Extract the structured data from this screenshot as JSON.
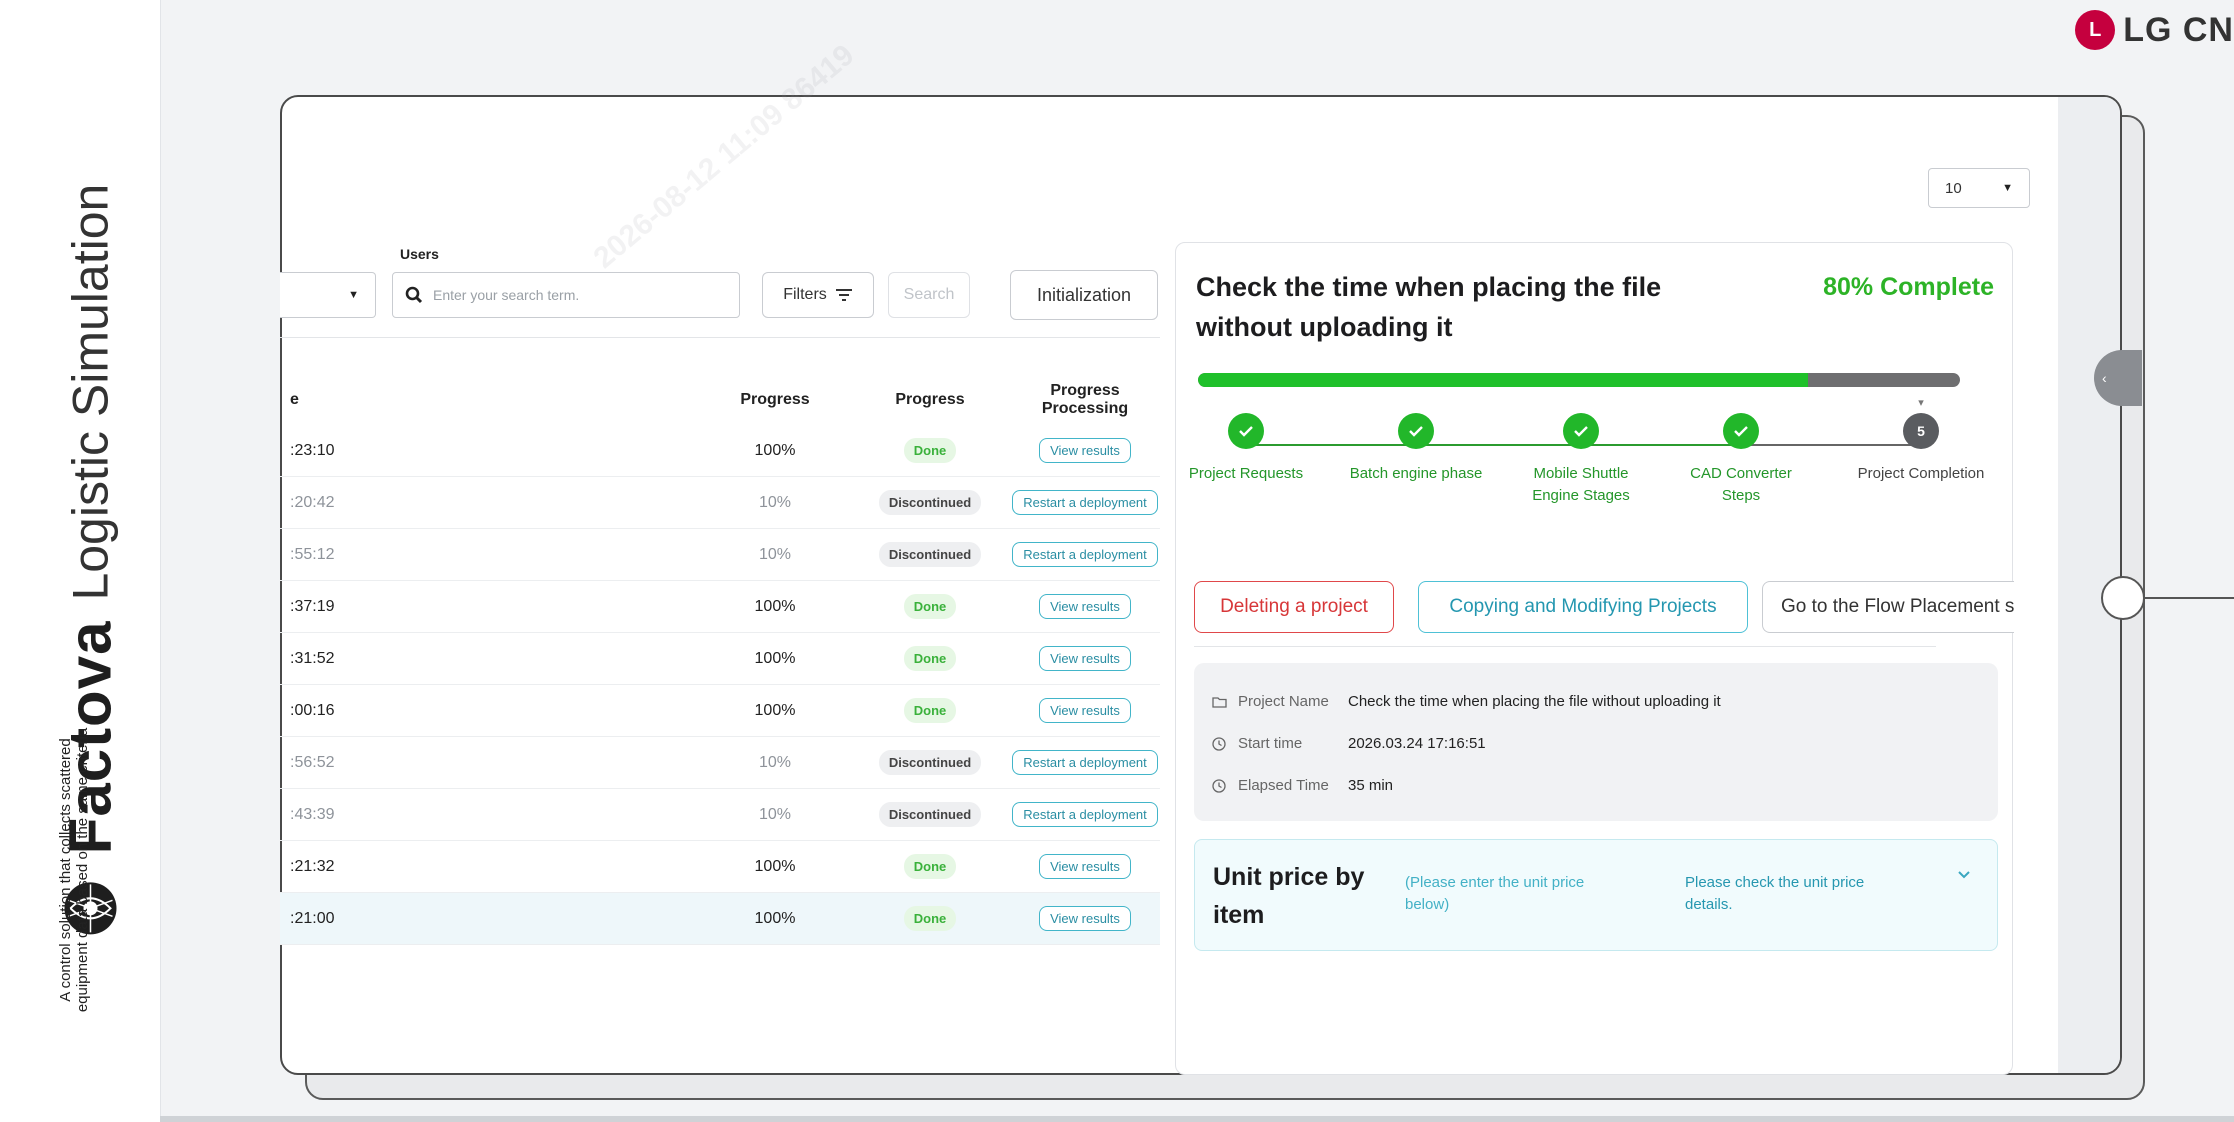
{
  "brand": {
    "name": "Factova",
    "subtitle": "Logistic Simulation",
    "tagline": "A control solution that collects scattered equipment data based on the same criteria"
  },
  "lg_logo": {
    "text": "LG CN",
    "color": "#c5003e"
  },
  "page_size": {
    "value": "10"
  },
  "filters": {
    "users_label": "Users",
    "search_placeholder": "Enter your search term.",
    "filters_label": "Filters",
    "search_label": "Search",
    "init_label": "Initialization"
  },
  "table": {
    "headers": [
      "e",
      "Progress",
      "Progress",
      "Progress Processing"
    ],
    "rows": [
      {
        "time": ":23:10",
        "progress": "100%",
        "status": "Done",
        "action": "View results",
        "dim": false
      },
      {
        "time": ":20:42",
        "progress": "10%",
        "status": "Discontinued",
        "action": "Restart a deployment",
        "dim": true
      },
      {
        "time": ":55:12",
        "progress": "10%",
        "status": "Discontinued",
        "action": "Restart a deployment",
        "dim": true
      },
      {
        "time": ":37:19",
        "progress": "100%",
        "status": "Done",
        "action": "View results",
        "dim": false
      },
      {
        "time": ":31:52",
        "progress": "100%",
        "status": "Done",
        "action": "View results",
        "dim": false
      },
      {
        "time": ":00:16",
        "progress": "100%",
        "status": "Done",
        "action": "View results",
        "dim": false
      },
      {
        "time": ":56:52",
        "progress": "10%",
        "status": "Discontinued",
        "action": "Restart a deployment",
        "dim": true
      },
      {
        "time": ":43:39",
        "progress": "10%",
        "status": "Discontinued",
        "action": "Restart a deployment",
        "dim": true
      },
      {
        "time": ":21:32",
        "progress": "100%",
        "status": "Done",
        "action": "View results",
        "dim": false
      },
      {
        "time": ":21:00",
        "progress": "100%",
        "status": "Done",
        "action": "View results",
        "dim": false
      }
    ]
  },
  "panel": {
    "title": "Check the time when placing the file without uploading it",
    "complete_text": "80% Complete",
    "progress_fraction": 0.8,
    "steps": [
      {
        "label": "Project Requests",
        "state": "done",
        "num": ""
      },
      {
        "label": "Batch engine phase",
        "state": "done",
        "num": ""
      },
      {
        "label": "Mobile Shuttle Engine Stages",
        "state": "done",
        "num": ""
      },
      {
        "label": "CAD Converter Steps",
        "state": "done",
        "num": ""
      },
      {
        "label": "Project Completion",
        "state": "current",
        "num": "5"
      }
    ],
    "actions": {
      "delete": "Deleting a project",
      "copy": "Copying and Modifying Projects",
      "flow": "Go to the Flow Placement scr"
    },
    "info": {
      "project_name_label": "Project Name",
      "project_name_value": "Check the time when placing the file without uploading it",
      "start_time_label": "Start time",
      "start_time_value": "2026.03.24 17:16:51",
      "elapsed_label": "Elapsed Time",
      "elapsed_value": "35 min"
    },
    "unit_price": {
      "title": "Unit price by item",
      "hint_enter": "(Please enter the unit price below)",
      "hint_check": "Please check the unit price details."
    }
  },
  "colors": {
    "done_green": "#22b72a",
    "delete_red": "#e0484a",
    "accent_teal": "#4ec1d6"
  }
}
